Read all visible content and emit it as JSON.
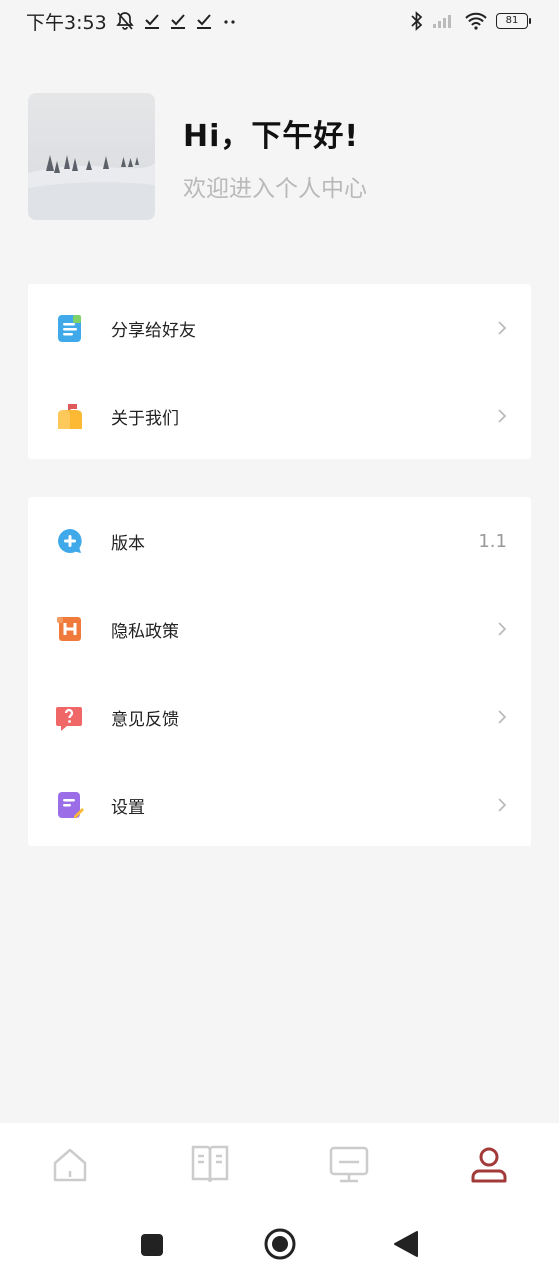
{
  "status_bar": {
    "time": "下午3:53",
    "battery": "81"
  },
  "header": {
    "title": "Hi，下午好!",
    "subtitle": "欢迎进入个人中心"
  },
  "menu_group_1": [
    {
      "label": "分享给好友",
      "icon": "share-doc-icon"
    },
    {
      "label": "关于我们",
      "icon": "mailbox-icon"
    }
  ],
  "menu_group_2": [
    {
      "label": "版本",
      "icon": "chat-plus-icon",
      "value": "1.1"
    },
    {
      "label": "隐私政策",
      "icon": "privacy-h-icon"
    },
    {
      "label": "意见反馈",
      "icon": "question-bubble-icon"
    },
    {
      "label": "设置",
      "icon": "settings-note-icon"
    }
  ],
  "tab_bar": {
    "tabs": [
      "home-icon",
      "book-icon",
      "monitor-icon",
      "profile-icon"
    ],
    "active": "profile-icon"
  },
  "colors": {
    "accent": "#a33a3a",
    "background": "#f5f5f5",
    "tab_inactive": "#cccccc"
  }
}
